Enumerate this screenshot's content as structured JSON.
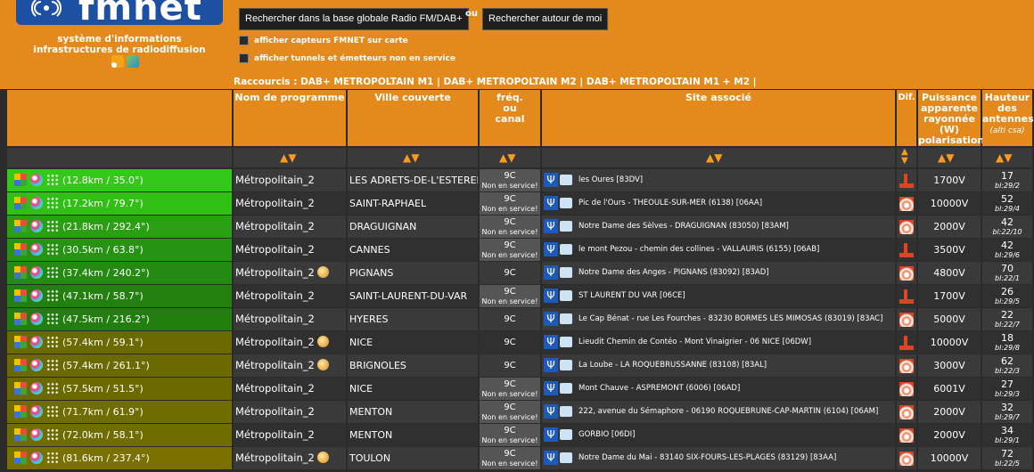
{
  "brand": {
    "logo_text": "fmnet",
    "tagline_1": "système d'informations",
    "tagline_2": "infrastructures de radiodiffusion"
  },
  "search": {
    "global_label": "Rechercher dans la base globale Radio FM/DAB+",
    "or_label": "ou",
    "nearby_label": "Rechercher autour de moi"
  },
  "options": {
    "show_sensors": "afficher capteurs FMNET sur carte",
    "show_tunnels": "afficher tunnels et émetteurs non en service"
  },
  "shortcuts": {
    "prefix": "Raccourcis :",
    "links": [
      "DAB+ METROPOLTAIN M1",
      "DAB+ METROPOLTAIN M2",
      "DAB+ METROPOLTAIN M1 + M2"
    ],
    "sep": "|"
  },
  "columns": {
    "programme": "Nom de programme",
    "ville": "Ville couverte",
    "freq_1": "fréq.",
    "freq_2": "ou",
    "freq_3": "canal",
    "site": "Site associé",
    "dif": "Dif.",
    "power_1": "Puissance",
    "power_2": "apparente",
    "power_3": "rayonnée",
    "power_4": "(W)",
    "power_5": "polarisation",
    "height_1": "Hauteur",
    "height_2": "des",
    "height_3": "antennes",
    "height_4": "(alti csa)"
  },
  "colors": {
    "header_orange": "#e48a1c",
    "row_green_near": "#3fbf1f",
    "row_olive_far": "#7a7000"
  },
  "rows": [
    {
      "dist": "(12.8km / 35.0°)",
      "prog": "Métropolitain_2",
      "badge": false,
      "ville": "LES ADRETS-DE-L'ESTEREL",
      "freq": "9C",
      "ns": "Non en service!",
      "site": "les Oures [83DV]",
      "dif": "red",
      "power": "1700V",
      "height": "17",
      "sub": "bl:29/2",
      "color": "#34c81a"
    },
    {
      "dist": "(17.2km / 79.7°)",
      "prog": "Métropolitain_2",
      "badge": false,
      "ville": "SAINT-RAPHAEL",
      "freq": "9C",
      "ns": "Non en service!",
      "site": "Pic de l'Ours - THEOULE-SUR-MER (6138) [06AA]",
      "dif": "orange",
      "power": "10000V",
      "height": "52",
      "sub": "bl:29/4",
      "color": "#2fbf15"
    },
    {
      "dist": "(21.8km / 292.4°)",
      "prog": "Métropolitain_2",
      "badge": false,
      "ville": "DRAGUIGNAN",
      "freq": "9C",
      "ns": "Non en service!",
      "site": "Notre Dame des Sèlves - DRAGUIGNAN (83050) [83AM]",
      "dif": "orange",
      "power": "2000V",
      "height": "42",
      "sub": "bl:22/10",
      "color": "#2a9f14"
    },
    {
      "dist": "(30.5km / 63.8°)",
      "prog": "Métropolitain_2",
      "badge": false,
      "ville": "CANNES",
      "freq": "9C",
      "ns": "Non en service!",
      "site": "le mont Pezou - chemin des collines - VALLAURIS (6155) [06AB]",
      "dif": "red",
      "power": "3500V",
      "height": "42",
      "sub": "bl:29/6",
      "color": "#279313"
    },
    {
      "dist": "(37.4km / 240.2°)",
      "prog": "Métropolitain_2",
      "badge": true,
      "ville": "PIGNANS",
      "freq": "9C",
      "ns": "",
      "site": "Notre Dame des Anges - PIGNANS (83092) [83AD]",
      "dif": "orange",
      "power": "4800V",
      "height": "70",
      "sub": "bl:22/1",
      "color": "#248a12"
    },
    {
      "dist": "(47.1km / 58.7°)",
      "prog": "Métropolitain_2",
      "badge": false,
      "ville": "SAINT-LAURENT-DU-VAR",
      "freq": "9C",
      "ns": "Non en service!",
      "site": "ST LAURENT DU VAR [06CE]",
      "dif": "red",
      "power": "1700V",
      "height": "26",
      "sub": "bl:29/5",
      "color": "#237f10"
    },
    {
      "dist": "(47.5km / 216.2°)",
      "prog": "Métropolitain_2",
      "badge": false,
      "ville": "HYERES",
      "freq": "9C",
      "ns": "",
      "site": "Le Cap Bénat - rue Les Fourches - 83230 BORMES LES MIMOSAS (83019) [83AC]",
      "dif": "orange",
      "power": "5000V",
      "height": "22",
      "sub": "bl:22/7",
      "color": "#237e10"
    },
    {
      "dist": "(57.4km / 59.1°)",
      "prog": "Métropolitain_2",
      "badge": true,
      "ville": "NICE",
      "freq": "9C",
      "ns": "",
      "site": "Lieudit Chemin de Contéo - Mont Vinaigrier - 06 NICE [06DW]",
      "dif": "red",
      "power": "10000V",
      "height": "18",
      "sub": "bl:29/8",
      "color": "#6b6a00"
    },
    {
      "dist": "(57.4km / 261.1°)",
      "prog": "Métropolitain_2",
      "badge": true,
      "ville": "BRIGNOLES",
      "freq": "9C",
      "ns": "",
      "site": "La Loube - LA ROQUEBRUSSANNE (83108) [83AL]",
      "dif": "orange",
      "power": "3000V",
      "height": "62",
      "sub": "bl:22/3",
      "color": "#6b6a00"
    },
    {
      "dist": "(57.5km / 51.5°)",
      "prog": "Métropolitain_2",
      "badge": false,
      "ville": "NICE",
      "freq": "9C",
      "ns": "Non en service!",
      "site": "Mont Chauve - ASPREMONT (6006) [06AD]",
      "dif": "orange",
      "power": "6001V",
      "height": "27",
      "sub": "bl:29/3",
      "color": "#6b6a00"
    },
    {
      "dist": "(71.7km / 61.9°)",
      "prog": "Métropolitain_2",
      "badge": false,
      "ville": "MENTON",
      "freq": "9C",
      "ns": "Non en service!",
      "site": "222, avenue du Sémaphore - 06190 ROQUEBRUNE-CAP-MARTIN (6104) [06AM]",
      "dif": "orange",
      "power": "2000V",
      "height": "32",
      "sub": "bl:29/7",
      "color": "#6f6c00"
    },
    {
      "dist": "(72.0km / 58.1°)",
      "prog": "Métropolitain_2",
      "badge": false,
      "ville": "MENTON",
      "freq": "9C",
      "ns": "Non en service!",
      "site": "GORBIO [06DI]",
      "dif": "orange",
      "power": "2000V",
      "height": "34",
      "sub": "bl:29/1",
      "color": "#6f6c00"
    },
    {
      "dist": "(81.6km / 237.4°)",
      "prog": "Métropolitain_2",
      "badge": true,
      "ville": "TOULON",
      "freq": "9C",
      "ns": "Non en service!",
      "site": "Notre Dame du Mai - 83140 SIX-FOURS-LES-PLAGES (83129) [83AA]",
      "dif": "orange",
      "power": "10000V",
      "height": "72",
      "sub": "bl:22/5",
      "color": "#7a7000"
    }
  ]
}
